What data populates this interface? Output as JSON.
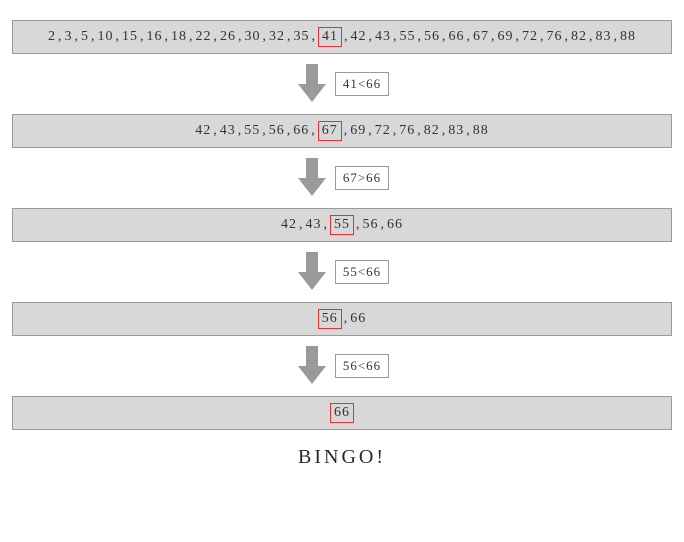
{
  "steps": [
    {
      "numbers": [
        2,
        3,
        5,
        10,
        15,
        16,
        18,
        22,
        26,
        30,
        32,
        35,
        41,
        42,
        43,
        55,
        56,
        66,
        67,
        69,
        72,
        76,
        82,
        83,
        88
      ],
      "highlightIndex": 12
    },
    {
      "numbers": [
        42,
        43,
        55,
        56,
        66,
        67,
        69,
        72,
        76,
        82,
        83,
        88
      ],
      "highlightIndex": 5
    },
    {
      "numbers": [
        42,
        43,
        55,
        56,
        66
      ],
      "highlightIndex": 2
    },
    {
      "numbers": [
        56,
        66
      ],
      "highlightIndex": 0
    },
    {
      "numbers": [
        66
      ],
      "highlightIndex": 0
    }
  ],
  "arrows": [
    {
      "label": "41<66"
    },
    {
      "label": "67>66"
    },
    {
      "label": "55<66"
    },
    {
      "label": "56<66"
    }
  ],
  "bingo": "BINGO!"
}
